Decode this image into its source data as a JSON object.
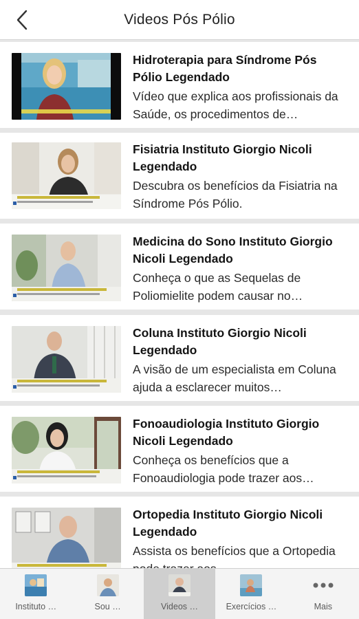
{
  "header": {
    "title": "Videos Pós Pólio",
    "back_icon": "chevron-left-icon"
  },
  "videos": [
    {
      "title": "Hidroterapia para Síndrome Pós Pólio Legendado",
      "description": "Vídeo que explica aos profissionais da Saúde, os procedimentos de…"
    },
    {
      "title": "Fisiatria Instituto Giorgio Nicoli Legendado",
      "description": "Descubra os benefícios da Fisiatria na Síndrome Pós Pólio."
    },
    {
      "title": "Medicina do Sono Instituto Giorgio Nicoli Legendado",
      "description": "Conheça o que as Sequelas de Poliomielite podem causar no…"
    },
    {
      "title": "Coluna Instituto Giorgio Nicoli Legendado",
      "description": "A visão de um especialista em Coluna ajuda a esclarecer muitos…"
    },
    {
      "title": "Fonoaudiologia Instituto Giorgio Nicoli Legendado",
      "description": "Conheça os benefícios que a Fonoaudiologia pode trazer aos…"
    },
    {
      "title": "Ortopedia Instituto Giorgio Nicoli Legendado",
      "description": "Assista os benefícios que a Ortopedia pode trazer aos…"
    }
  ],
  "tabs": [
    {
      "label": "Instituto …",
      "icon": "instituto-thumbnail-icon",
      "active": false
    },
    {
      "label": "Sou …",
      "icon": "sou-thumbnail-icon",
      "active": false
    },
    {
      "label": "Videos …",
      "icon": "videos-thumbnail-icon",
      "active": true
    },
    {
      "label": "Exercícios …",
      "icon": "exercicios-thumbnail-icon",
      "active": false
    },
    {
      "label": "Mais",
      "icon": "more-dots-icon",
      "active": false
    }
  ],
  "colors": {
    "header_bg": "#ffffff",
    "list_bg": "#e6e6e6",
    "tabbar_bg": "#f4f4f4",
    "tab_active_bg": "#cfcfcf",
    "caption_yellow": "#e8d84a"
  }
}
